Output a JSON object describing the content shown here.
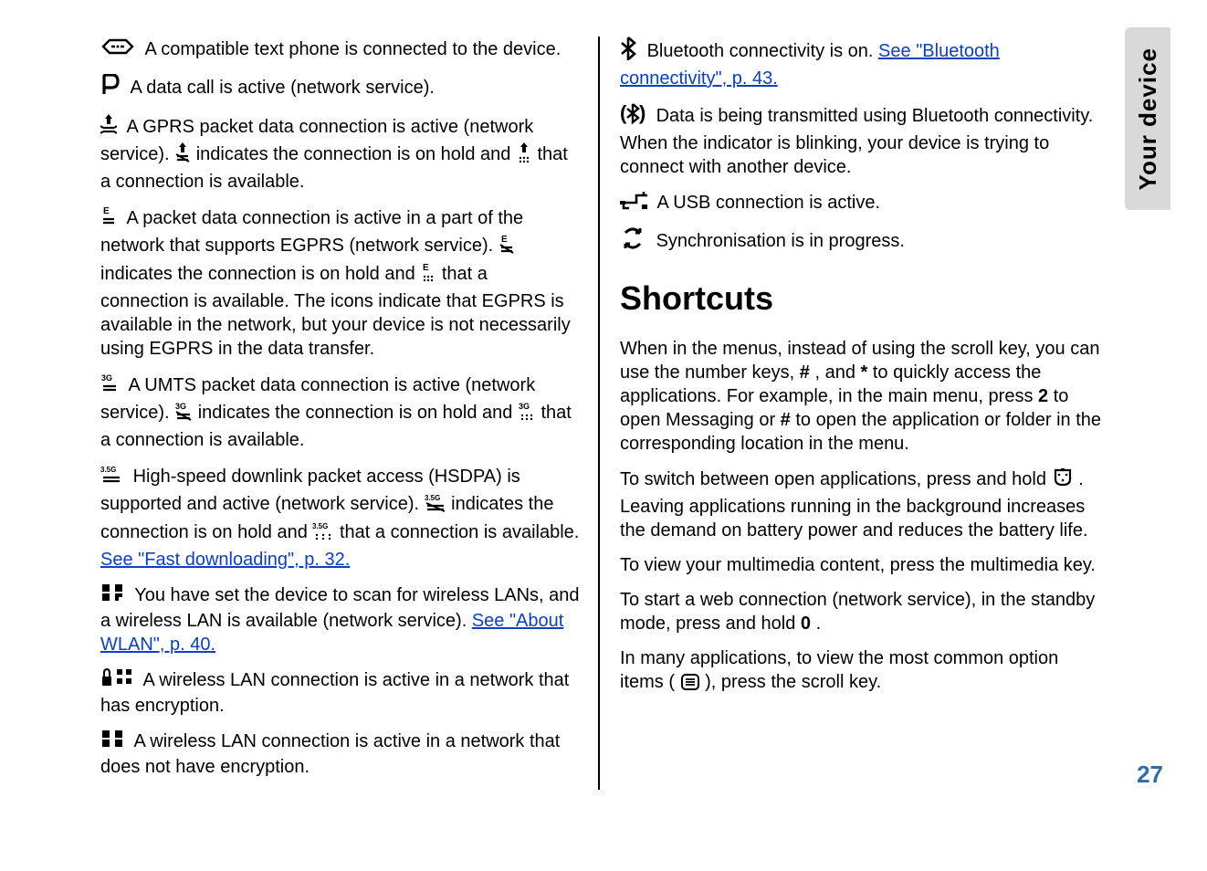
{
  "sideTab": "Your device",
  "pageNumber": "27",
  "left": {
    "textphone": "A compatible text phone is connected to the device.",
    "datacall": "A data call is active (network service).",
    "gprs_a": "A GPRS packet data connection is active (network service). ",
    "gprs_b": " indicates the connection is on hold and ",
    "gprs_c": " that a connection is available.",
    "egprs_a": "A packet data connection is active in a part of the network that supports EGPRS (network service). ",
    "egprs_b": " indicates the connection is on hold and ",
    "egprs_c": " that a connection is available. The icons indicate that EGPRS is available in the network, but your device is not necessarily using EGPRS in the data transfer.",
    "umts_a": "A UMTS packet data connection is active (network service). ",
    "umts_b": " indicates the connection is on hold and ",
    "umts_c": " that a connection is available.",
    "hsdpa_a": "High-speed downlink packet access (HSDPA) is supported and active (network service). ",
    "hsdpa_b": " indicates the connection is on hold and ",
    "hsdpa_c": " that a connection is available. ",
    "hsdpa_link": "See \"Fast downloading\", p. 32.",
    "wlan_scan_a": "You have set the device to scan for wireless LANs, and a wireless LAN is available (network service). ",
    "wlan_scan_link": "See \"About WLAN\", p. 40.",
    "wlan_enc": "A wireless LAN connection is active in a network that has encryption.",
    "wlan_noenc": "A wireless LAN connection is active in a network that does not have encryption."
  },
  "right": {
    "bt_on_a": "Bluetooth connectivity is on. ",
    "bt_on_link": "See \"Bluetooth connectivity\", p. 43.",
    "bt_tx": "Data is being transmitted using Bluetooth connectivity. When the indicator is blinking, your device is trying to connect with another device.",
    "usb": "A USB connection is active.",
    "sync": "Synchronisation is in progress.",
    "shortcuts_heading": "Shortcuts",
    "shortcuts_p1_a": "When in the menus, instead of using the scroll key, you can use the number keys, ",
    "hash1": "#",
    "shortcuts_p1_b": ", and ",
    "star": "*",
    "shortcuts_p1_c": " to quickly access the applications. For example, in the main menu, press ",
    "two": "2",
    "shortcuts_p1_d": " to open Messaging or ",
    "hash2": "#",
    "shortcuts_p1_e": " to open the application or folder in the corresponding location in the menu.",
    "shortcuts_p2_a": "To switch between open applications, press and hold ",
    "shortcuts_p2_b": " . Leaving applications running in the background increases the demand on battery power and reduces the battery life.",
    "shortcuts_p3": "To view your multimedia content, press the multimedia key.",
    "shortcuts_p4_a": "To start a web connection (network service), in the standby mode, press and hold ",
    "zero": "0",
    "shortcuts_p4_b": ".",
    "shortcuts_p5_a": "In many applications, to view the most common option items (",
    "shortcuts_p5_b": "), press the scroll key."
  }
}
